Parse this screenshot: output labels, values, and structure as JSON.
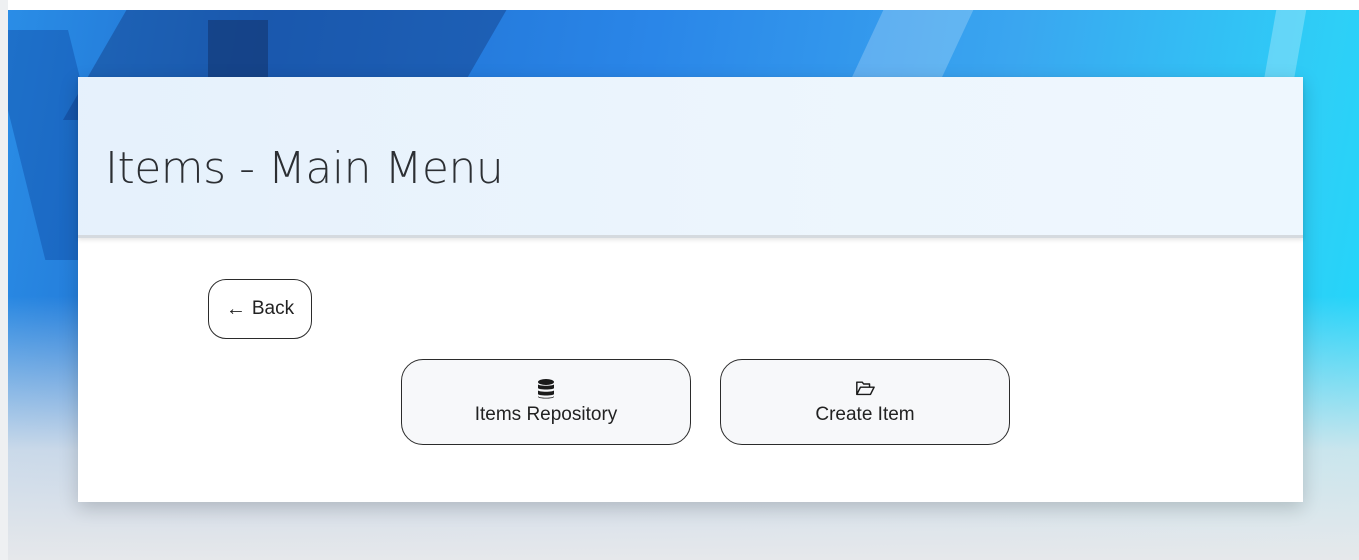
{
  "page": {
    "title": "Items - Main Menu"
  },
  "nav": {
    "back_label": "Back",
    "back_icon": "arrow-left-icon"
  },
  "menu": {
    "items": [
      {
        "label": "Items Repository",
        "icon": "database-icon"
      },
      {
        "label": "Create Item",
        "icon": "folder-open-icon"
      }
    ]
  },
  "colors": {
    "background_blue": "#2a86e8",
    "background_cyan": "#1fd8fb",
    "button_border": "#2b2b2b",
    "text": "#222222"
  }
}
